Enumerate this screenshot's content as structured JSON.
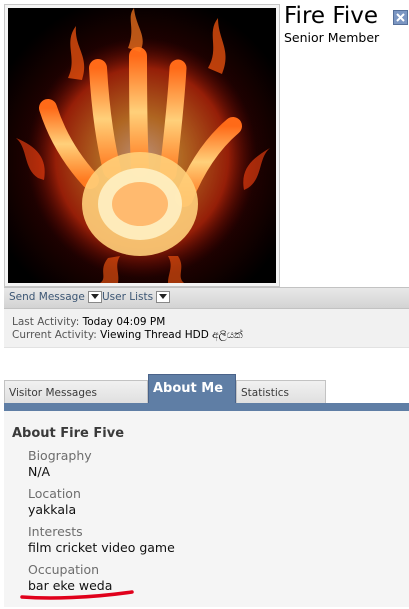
{
  "profile": {
    "username": "Fire Five",
    "usertitle": "Senior Member"
  },
  "icons": {
    "avatar": "flaming-hand-image",
    "close": "close-icon",
    "dropdown": "chevron-down-icon"
  },
  "actions": {
    "send_message": "Send Message",
    "user_lists": "User Lists"
  },
  "activity": {
    "last_label": "Last Activity:",
    "last_value": "Today 04:09 PM",
    "current_label": "Current Activity:",
    "current_value": "Viewing Thread HDD අලියක්"
  },
  "tabs": [
    {
      "label": "Visitor Messages",
      "active": false
    },
    {
      "label": "About Me",
      "active": true
    },
    {
      "label": "Statistics",
      "active": false
    }
  ],
  "about": {
    "title": "About Fire Five",
    "fields": [
      {
        "label": "Biography",
        "value": "N/A"
      },
      {
        "label": "Location",
        "value": "yakkala"
      },
      {
        "label": "Interests",
        "value": "film cricket video game"
      },
      {
        "label": "Occupation",
        "value": "bar eke weda"
      }
    ]
  },
  "colors": {
    "accent": "#5f7ea5",
    "annotation": "#e0001b"
  }
}
